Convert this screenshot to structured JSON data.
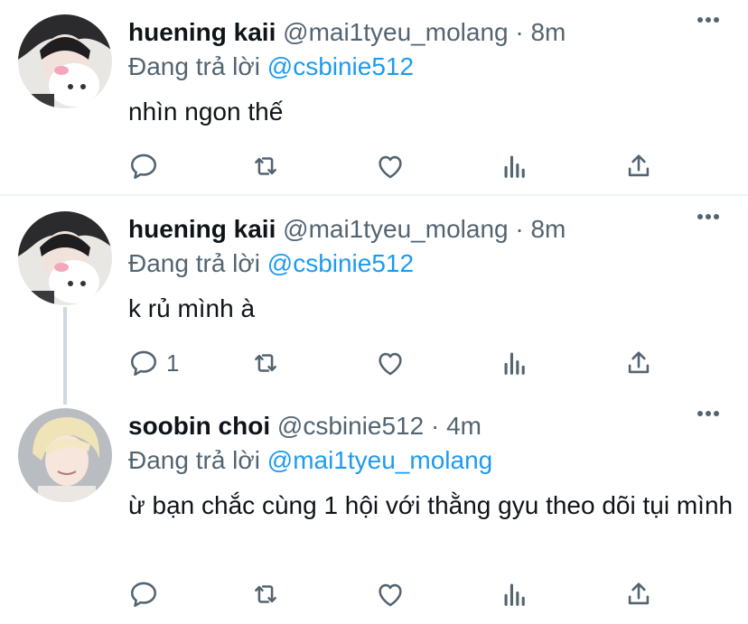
{
  "tweets": [
    {
      "name": "huening kaii",
      "handle": "@mai1tyeu_molang",
      "dot": "·",
      "time": "8m",
      "reply_prefix": "Đang trả lời",
      "reply_to": "@csbinie512",
      "text": "nhìn ngon thế",
      "reply_count": "",
      "avatar_icon": "avatar-boy-with-plush"
    },
    {
      "name": "huening kaii",
      "handle": "@mai1tyeu_molang",
      "dot": "·",
      "time": "8m",
      "reply_prefix": "Đang trả lời",
      "reply_to": "@csbinie512",
      "text": "k rủ mình à",
      "reply_count": "1",
      "avatar_icon": "avatar-boy-with-plush"
    },
    {
      "name": "soobin choi",
      "handle": "@csbinie512",
      "dot": "·",
      "time": "4m",
      "reply_prefix": "Đang trả lời",
      "reply_to": "@mai1tyeu_molang",
      "text": "ừ bạn chắc cùng 1 hội với thằng gyu theo dõi tụi mình",
      "reply_count": "",
      "avatar_icon": "avatar-blonde-person"
    }
  ],
  "colors": {
    "accent": "#1d9bf0",
    "secondary_text": "#536471",
    "primary_text": "#0f1419",
    "divider": "#eff3f4"
  },
  "icons": [
    "more-icon",
    "reply-icon",
    "retweet-icon",
    "like-icon",
    "analytics-icon",
    "share-icon"
  ]
}
